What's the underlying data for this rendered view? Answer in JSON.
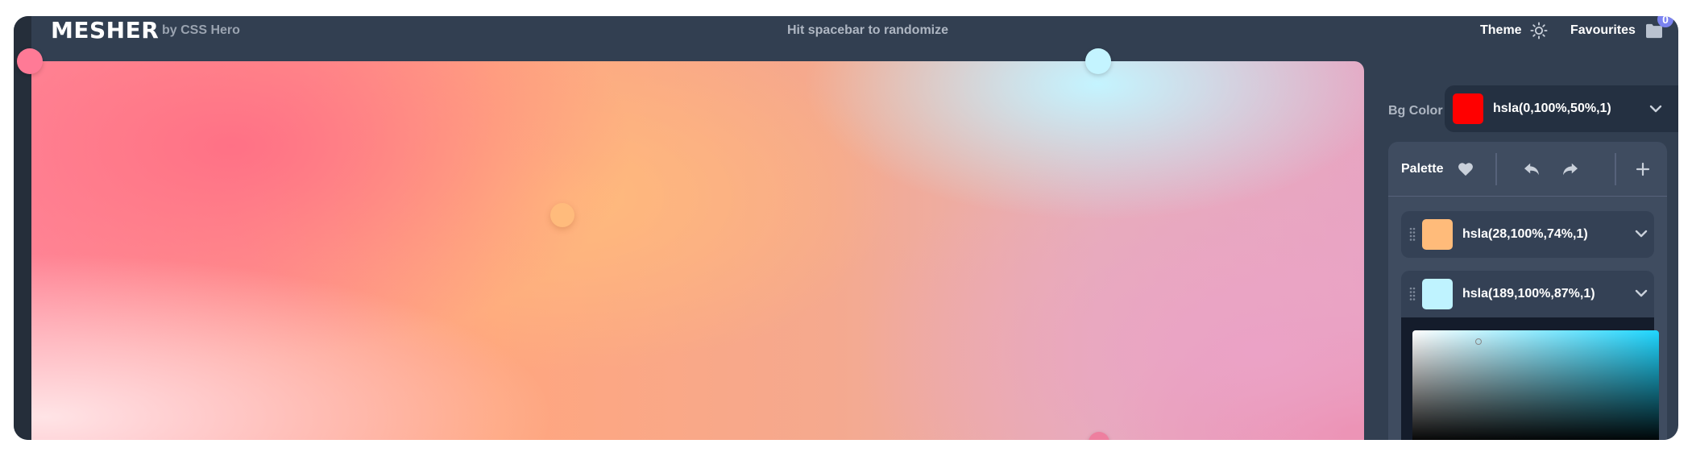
{
  "header": {
    "logo": "MESHER",
    "byline": "by CSS Hero",
    "hint": "Hit spacebar to randomize",
    "theme_label": "Theme",
    "favourites_label": "Favourites",
    "favourites_count": "0"
  },
  "canvas": {
    "handles": [
      {
        "name": "point-1",
        "color": "#ff7a96"
      },
      {
        "name": "point-2",
        "color": "#ffbb7c"
      },
      {
        "name": "point-3",
        "color": "#c4f4ff"
      },
      {
        "name": "point-4",
        "color": "#ee7f9f"
      }
    ]
  },
  "sidebar": {
    "bg_color_label": "Bg Color",
    "bg_color_value": "hsla(0,100%,50%,1)",
    "bg_color_swatch": "#ff0000",
    "palette_label": "Palette",
    "colors": [
      {
        "value": "hsla(28,100%,74%,1)",
        "swatch": "#ffbb7a"
      },
      {
        "value": "hsla(189,100%,87%,1)",
        "swatch": "#bff3ff"
      }
    ]
  },
  "icons": {
    "theme": "sun-icon",
    "favourites": "folder-icon",
    "favorite": "heart-icon",
    "undo": "undo-icon",
    "redo": "redo-icon",
    "add": "plus-icon",
    "chevron": "chevron-down-icon",
    "drag": "drag-handle-icon"
  }
}
